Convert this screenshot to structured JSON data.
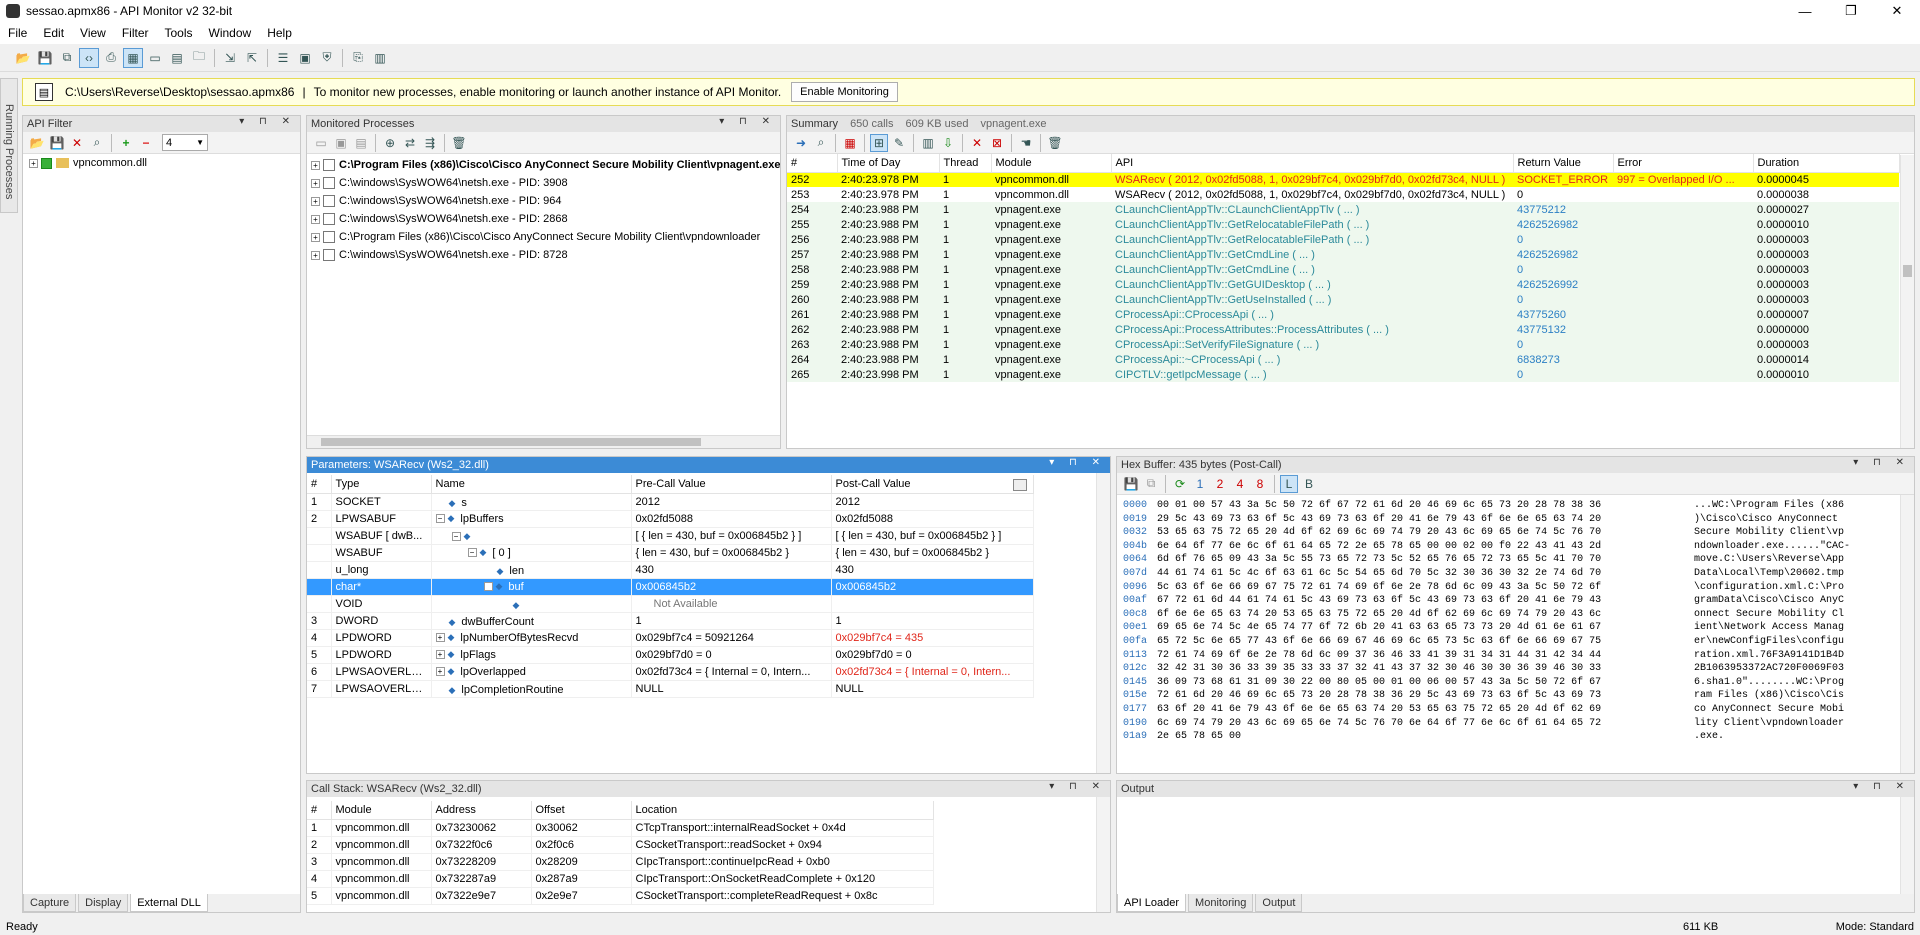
{
  "window": {
    "title": "sessao.apmx86 - API Monitor v2 32-bit",
    "minimize": "—",
    "maximize": "❐",
    "close": "✕"
  },
  "menu": [
    "File",
    "Edit",
    "View",
    "Filter",
    "Tools",
    "Window",
    "Help"
  ],
  "infobar": {
    "path": "C:\\Users\\Reverse\\Desktop\\sessao.apmx86",
    "sep": "|",
    "message": "To monitor new processes, enable monitoring or launch another instance of API Monitor.",
    "button": "Enable Monitoring"
  },
  "sidetab": "Running Processes",
  "api_filter": {
    "title": "API Filter",
    "level": "4",
    "tree_item": "vpncommon.dll",
    "tabs": [
      "Capture",
      "Display",
      "External DLL"
    ]
  },
  "monitored": {
    "title": "Monitored Processes",
    "items": [
      {
        "label": "C:\\Program Files (x86)\\Cisco\\Cisco AnyConnect Secure Mobility Client\\vpnagent.exe",
        "bold": true
      },
      {
        "label": "C:\\windows\\SysWOW64\\netsh.exe - PID: 3908",
        "bold": false
      },
      {
        "label": "C:\\windows\\SysWOW64\\netsh.exe - PID: 964",
        "bold": false
      },
      {
        "label": "C:\\windows\\SysWOW64\\netsh.exe - PID: 2868",
        "bold": false
      },
      {
        "label": "C:\\Program Files (x86)\\Cisco\\Cisco AnyConnect Secure Mobility Client\\vpndownloader",
        "bold": false
      },
      {
        "label": "C:\\windows\\SysWOW64\\netsh.exe - PID: 8728",
        "bold": false
      }
    ]
  },
  "summary": {
    "tabs": [
      "Summary",
      "650 calls",
      "609 KB used",
      "vpnagent.exe"
    ],
    "columns": [
      "#",
      "Time of Day",
      "Thread",
      "Module",
      "API",
      "Return Value",
      "Error",
      "Duration"
    ],
    "rows": [
      {
        "n": "252",
        "time": "2:40:23.978 PM",
        "thread": "1",
        "module": "vpncommon.dll",
        "api": "WSARecv ( 2012, 0x02fd5088, 1, 0x029bf7c4, 0x029bf7d0, 0x02fd73c4, NULL )",
        "ret": "SOCKET_ERROR",
        "err": "997 = Overlapped I/O ...",
        "dur": "0.0000045",
        "style": "yellow"
      },
      {
        "n": "253",
        "time": "2:40:23.978 PM",
        "thread": "1",
        "module": "vpncommon.dll",
        "api": "WSARecv ( 2012, 0x02fd5088, 1, 0x029bf7c4, 0x029bf7d0, 0x02fd73c4, NULL )",
        "ret": "0",
        "err": "",
        "dur": "0.0000038",
        "style": "plain"
      },
      {
        "n": "254",
        "time": "2:40:23.988 PM",
        "thread": "1",
        "module": "vpnagent.exe",
        "api": "CLaunchClientAppTlv::CLaunchClientAppTlv ( ... )",
        "ret": "43775212",
        "err": "",
        "dur": "0.0000027",
        "style": "green"
      },
      {
        "n": "255",
        "time": "2:40:23.988 PM",
        "thread": "1",
        "module": "vpnagent.exe",
        "api": "CLaunchClientAppTlv::GetRelocatableFilePath ( ... )",
        "ret": "4262526982",
        "err": "",
        "dur": "0.0000010",
        "style": "green"
      },
      {
        "n": "256",
        "time": "2:40:23.988 PM",
        "thread": "1",
        "module": "vpnagent.exe",
        "api": "CLaunchClientAppTlv::GetRelocatableFilePath ( ... )",
        "ret": "0",
        "err": "",
        "dur": "0.0000003",
        "style": "green"
      },
      {
        "n": "257",
        "time": "2:40:23.988 PM",
        "thread": "1",
        "module": "vpnagent.exe",
        "api": "CLaunchClientAppTlv::GetCmdLine ( ... )",
        "ret": "4262526982",
        "err": "",
        "dur": "0.0000003",
        "style": "green"
      },
      {
        "n": "258",
        "time": "2:40:23.988 PM",
        "thread": "1",
        "module": "vpnagent.exe",
        "api": "CLaunchClientAppTlv::GetCmdLine ( ... )",
        "ret": "0",
        "err": "",
        "dur": "0.0000003",
        "style": "green"
      },
      {
        "n": "259",
        "time": "2:40:23.988 PM",
        "thread": "1",
        "module": "vpnagent.exe",
        "api": "CLaunchClientAppTlv::GetGUIDesktop ( ... )",
        "ret": "4262526992",
        "err": "",
        "dur": "0.0000003",
        "style": "green"
      },
      {
        "n": "260",
        "time": "2:40:23.988 PM",
        "thread": "1",
        "module": "vpnagent.exe",
        "api": "CLaunchClientAppTlv::GetUseInstalled ( ... )",
        "ret": "0",
        "err": "",
        "dur": "0.0000003",
        "style": "green"
      },
      {
        "n": "261",
        "time": "2:40:23.988 PM",
        "thread": "1",
        "module": "vpnagent.exe",
        "api": "CProcessApi::CProcessApi ( ... )",
        "ret": "43775260",
        "err": "",
        "dur": "0.0000007",
        "style": "green"
      },
      {
        "n": "262",
        "time": "2:40:23.988 PM",
        "thread": "1",
        "module": "vpnagent.exe",
        "api": "CProcessApi::ProcessAttributes::ProcessAttributes ( ... )",
        "ret": "43775132",
        "err": "",
        "dur": "0.0000000",
        "style": "green"
      },
      {
        "n": "263",
        "time": "2:40:23.988 PM",
        "thread": "1",
        "module": "vpnagent.exe",
        "api": "CProcessApi::SetVerifyFileSignature ( ... )",
        "ret": "0",
        "err": "",
        "dur": "0.0000003",
        "style": "green"
      },
      {
        "n": "264",
        "time": "2:40:23.988 PM",
        "thread": "1",
        "module": "vpnagent.exe",
        "api": "CProcessApi::~CProcessApi ( ... )",
        "ret": "6838273",
        "err": "",
        "dur": "0.0000014",
        "style": "green"
      },
      {
        "n": "265",
        "time": "2:40:23.998 PM",
        "thread": "1",
        "module": "vpnagent.exe",
        "api": "CIPCTLV::getIpcMessage ( ... )",
        "ret": "0",
        "err": "",
        "dur": "0.0000010",
        "style": "green"
      }
    ]
  },
  "params": {
    "title": "Parameters: WSARecv (Ws2_32.dll)",
    "columns": [
      "#",
      "Type",
      "Name",
      "Pre-Call Value",
      "Post-Call Value"
    ],
    "rows": [
      {
        "n": "1",
        "type": "SOCKET",
        "name": "s",
        "indent": 0,
        "exp": "",
        "pre": "2012",
        "post": "2012",
        "sel": false,
        "postRed": false
      },
      {
        "n": "2",
        "type": "LPWSABUF",
        "name": "lpBuffers",
        "indent": 0,
        "exp": "−",
        "pre": "0x02fd5088",
        "post": "0x02fd5088",
        "sel": false,
        "postRed": false
      },
      {
        "n": "",
        "type": "WSABUF [ dwB...",
        "name": "",
        "indent": 1,
        "exp": "−",
        "pre": "[ { len = 430, buf = 0x006845b2 } ]",
        "post": "[ { len = 430, buf = 0x006845b2 } ]",
        "sel": false,
        "postRed": false
      },
      {
        "n": "",
        "type": "WSABUF",
        "name": "[ 0 ]",
        "indent": 2,
        "exp": "−",
        "pre": "{ len = 430, buf = 0x006845b2 }",
        "post": "{ len = 430, buf = 0x006845b2 }",
        "sel": false,
        "postRed": false
      },
      {
        "n": "",
        "type": "u_long",
        "name": "len",
        "indent": 3,
        "exp": "",
        "pre": "430",
        "post": "430",
        "sel": false,
        "postRed": false
      },
      {
        "n": "",
        "type": "char*",
        "name": "buf",
        "indent": 3,
        "exp": "−",
        "pre": "0x006845b2",
        "post": "0x006845b2",
        "sel": true,
        "postRed": false
      },
      {
        "n": "",
        "type": "VOID",
        "name": "",
        "indent": 4,
        "exp": "",
        "pre": "Not Available",
        "post": "",
        "sel": false,
        "postRed": false
      },
      {
        "n": "3",
        "type": "DWORD",
        "name": "dwBufferCount",
        "indent": 0,
        "exp": "",
        "pre": "1",
        "post": "1",
        "sel": false,
        "postRed": false
      },
      {
        "n": "4",
        "type": "LPDWORD",
        "name": "lpNumberOfBytesRecvd",
        "indent": 0,
        "exp": "+",
        "pre": "0x029bf7c4 = 50921264",
        "post": "0x029bf7c4 = 435",
        "sel": false,
        "postRed": true
      },
      {
        "n": "5",
        "type": "LPDWORD",
        "name": "lpFlags",
        "indent": 0,
        "exp": "+",
        "pre": "0x029bf7d0 = 0",
        "post": "0x029bf7d0 = 0",
        "sel": false,
        "postRed": false
      },
      {
        "n": "6",
        "type": "LPWSAOVERLA...",
        "name": "lpOverlapped",
        "indent": 0,
        "exp": "+",
        "pre": "0x02fd73c4 = { Internal = 0, Intern...",
        "post": "0x02fd73c4 = { Internal = 0, Intern...",
        "sel": false,
        "postRed": true
      },
      {
        "n": "7",
        "type": "LPWSAOVERLA...",
        "name": "lpCompletionRoutine",
        "indent": 0,
        "exp": "",
        "pre": "NULL",
        "post": "NULL",
        "sel": false,
        "postRed": false
      }
    ]
  },
  "hex": {
    "title": "Hex Buffer: 435 bytes (Post-Call)",
    "offsets": [
      "0000",
      "0019",
      "0032",
      "004b",
      "0064",
      "007d",
      "0096",
      "00af",
      "00c8",
      "00e1",
      "00fa",
      "0113",
      "012c",
      "0145",
      "015e",
      "0177",
      "0190",
      "01a9"
    ],
    "bytes": [
      "00 01 00 57 43 3a 5c 50 72 6f 67 72 61 6d 20 46 69 6c 65 73 20 28 78 38 36",
      "29 5c 43 69 73 63 6f 5c 43 69 73 63 6f 20 41 6e 79 43 6f 6e 6e 65 63 74 20",
      "53 65 63 75 72 65 20 4d 6f 62 69 6c 69 74 79 20 43 6c 69 65 6e 74 5c 76 70",
      "6e 64 6f 77 6e 6c 6f 61 64 65 72 2e 65 78 65 00 00 02 00 f0 22 43 41 43 2d",
      "6d 6f 76 65 09 43 3a 5c 55 73 65 72 73 5c 52 65 76 65 72 73 65 5c 41 70 70",
      "44 61 74 61 5c 4c 6f 63 61 6c 5c 54 65 6d 70 5c 32 30 36 30 32 2e 74 6d 70",
      "5c 63 6f 6e 66 69 67 75 72 61 74 69 6f 6e 2e 78 6d 6c 09 43 3a 5c 50 72 6f",
      "67 72 61 6d 44 61 74 61 5c 43 69 73 63 6f 5c 43 69 73 63 6f 20 41 6e 79 43",
      "6f 6e 6e 65 63 74 20 53 65 63 75 72 65 20 4d 6f 62 69 6c 69 74 79 20 43 6c",
      "69 65 6e 74 5c 4e 65 74 77 6f 72 6b 20 41 63 63 65 73 73 20 4d 61 6e 61 67",
      "65 72 5c 6e 65 77 43 6f 6e 66 69 67 46 69 6c 65 73 5c 63 6f 6e 66 69 67 75",
      "72 61 74 69 6f 6e 2e 78 6d 6c 09 37 36 46 33 41 39 31 34 31 44 31 42 34 44",
      "32 42 31 30 36 33 39 35 33 33 37 32 41 43 37 32 30 46 30 30 36 39 46 30 33",
      "36 09 73 68 61 31 09 30 22 00 80 05 00 01 00 06 00 57 43 3a 5c 50 72 6f 67",
      "72 61 6d 20 46 69 6c 65 73 20 28 78 38 36 29 5c 43 69 73 63 6f 5c 43 69 73",
      "63 6f 20 41 6e 79 43 6f 6e 6e 65 63 74 20 53 65 63 75 72 65 20 4d 6f 62 69",
      "6c 69 74 79 20 43 6c 69 65 6e 74 5c 76 70 6e 64 6f 77 6e 6c 6f 61 64 65 72",
      "2e 65 78 65 00"
    ],
    "ascii": [
      "...WC:\\Program Files (x86",
      ")\\Cisco\\Cisco AnyConnect",
      "Secure Mobility Client\\vp",
      "ndownloader.exe......\"CAC-",
      "move.C:\\Users\\Reverse\\App",
      "Data\\Local\\Temp\\20602.tmp",
      "\\configuration.xml.C:\\Pro",
      "gramData\\Cisco\\Cisco AnyC",
      "onnect Secure Mobility Cl",
      "ient\\Network Access Manag",
      "er\\newConfigFiles\\configu",
      "ration.xml.76F3A9141D1B4D",
      "2B1063953372AC720F0069F03",
      "6.sha1.0\"........WC:\\Prog",
      "ram Files (x86)\\Cisco\\Cis",
      "co AnyConnect Secure Mobi",
      "lity Client\\vpndownloader",
      ".exe."
    ]
  },
  "callstack": {
    "title": "Call Stack: WSARecv (Ws2_32.dll)",
    "columns": [
      "#",
      "Module",
      "Address",
      "Offset",
      "Location"
    ],
    "rows": [
      {
        "n": "1",
        "module": "vpncommon.dll",
        "address": "0x73230062",
        "offset": "0x30062",
        "location": "CTcpTransport::internalReadSocket + 0x4d"
      },
      {
        "n": "2",
        "module": "vpncommon.dll",
        "address": "0x7322f0c6",
        "offset": "0x2f0c6",
        "location": "CSocketTransport::readSocket + 0x94"
      },
      {
        "n": "3",
        "module": "vpncommon.dll",
        "address": "0x73228209",
        "offset": "0x28209",
        "location": "CIpcTransport::continueIpcRead + 0xb0"
      },
      {
        "n": "4",
        "module": "vpncommon.dll",
        "address": "0x732287a9",
        "offset": "0x287a9",
        "location": "CIpcTransport::OnSocketReadComplete + 0x120"
      },
      {
        "n": "5",
        "module": "vpncommon.dll",
        "address": "0x7322e9e7",
        "offset": "0x2e9e7",
        "location": "CSocketTransport::completeReadRequest + 0x8c"
      }
    ]
  },
  "output": {
    "title": "Output",
    "tabs": [
      "API Loader",
      "Monitoring",
      "Output"
    ]
  },
  "status": {
    "left": "Ready",
    "size": "611 KB",
    "mode": "Mode: Standard"
  }
}
